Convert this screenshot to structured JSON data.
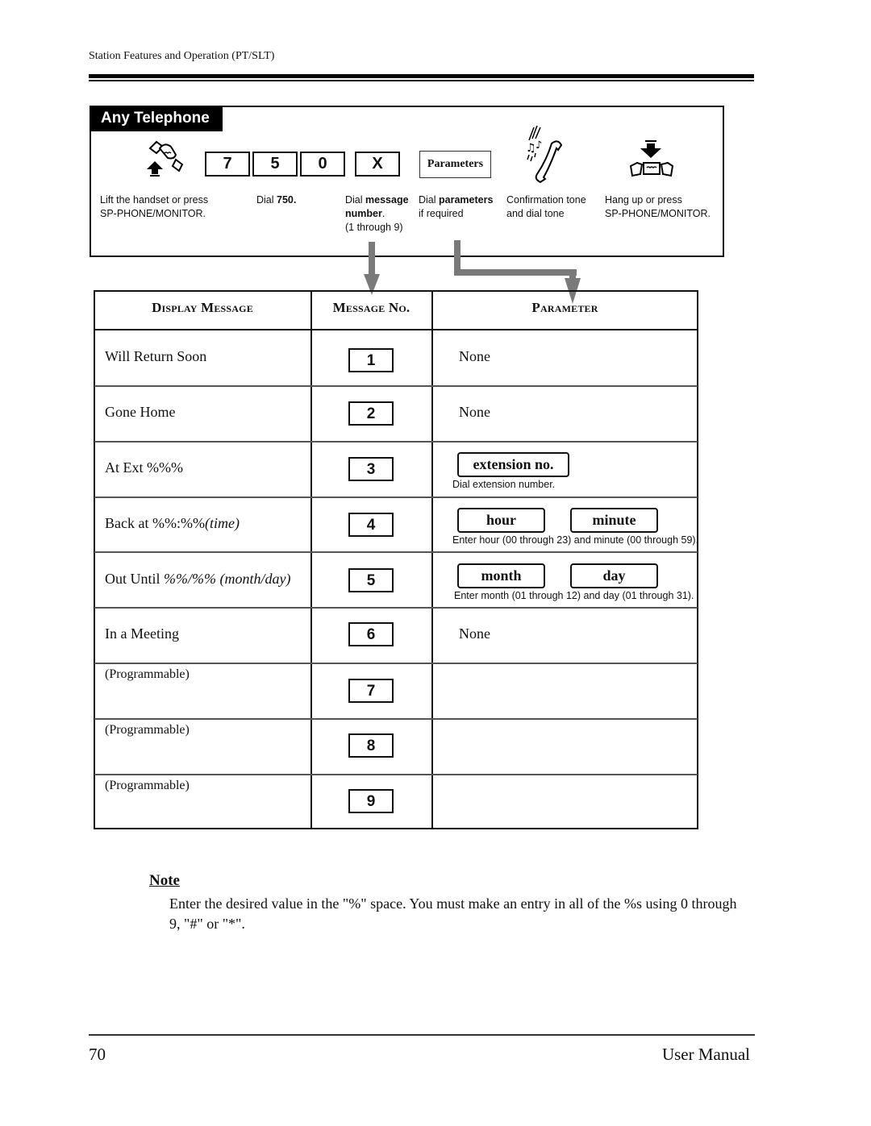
{
  "header": {
    "running_title": "Station Features and Operation (PT/SLT)"
  },
  "procedure": {
    "tab_label": "Any Telephone",
    "dial_keys": [
      "7",
      "5",
      "0"
    ],
    "message_key": "X",
    "parameters_key": "Parameters",
    "icons": [
      "off-hook-icon",
      "confirmation-tone-icon",
      "on-hook-icon"
    ],
    "steps": [
      {
        "lines": [
          "Lift the handset or press",
          "SP-PHONE/MONITOR."
        ]
      },
      {
        "prefix": "Dial ",
        "bold": "750."
      },
      {
        "prefix": "Dial ",
        "bold": "message",
        "bold2": "number",
        "suffix2": ".",
        "line3": "(1 through 9)"
      },
      {
        "prefix": "Dial ",
        "bold": "parameters",
        "line2": "if required"
      },
      {
        "lines": [
          "Confirmation tone",
          "and dial tone"
        ]
      },
      {
        "lines": [
          "Hang up or press",
          "SP-PHONE/MONITOR."
        ]
      }
    ]
  },
  "table": {
    "headers": [
      "Display Message",
      "Message No.",
      "Parameter"
    ],
    "rows": [
      {
        "message": "Will Return Soon",
        "number": "1",
        "parameter": "None"
      },
      {
        "message": "Gone Home",
        "number": "2",
        "parameter": "None"
      },
      {
        "message": "At Ext %%%",
        "number": "3",
        "param_boxes": [
          "extension no."
        ],
        "param_hint": "Dial extension number."
      },
      {
        "message": "Back at %%:%%",
        "message_italic": "(time)",
        "number": "4",
        "param_boxes": [
          "hour",
          "minute"
        ],
        "param_hint": "Enter hour (00 through 23) and minute (00 through 59)."
      },
      {
        "message": "Out Until ",
        "message_italic": "%%/%%  (month/day)",
        "number": "5",
        "param_boxes": [
          "month",
          "day"
        ],
        "param_hint": "Enter month (01 through 12) and day (01 through 31)."
      },
      {
        "message": "In a Meeting",
        "number": "6",
        "parameter": "None"
      },
      {
        "message": "(Programmable)",
        "number": "7",
        "parameter": ""
      },
      {
        "message": "(Programmable)",
        "number": "8",
        "parameter": ""
      },
      {
        "message": "(Programmable)",
        "number": "9",
        "parameter": ""
      }
    ]
  },
  "note": {
    "title": "Note",
    "body": "Enter the desired value in the \"%\" space. You must make an entry in all of the %s using 0 through 9, \"#\" or \"*\"."
  },
  "footer": {
    "page_number": "70",
    "manual_title": "User Manual"
  }
}
